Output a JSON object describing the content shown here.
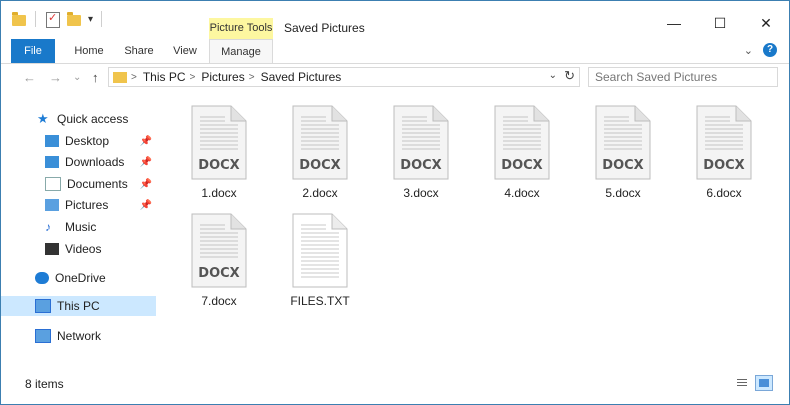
{
  "window": {
    "title": "Saved Pictures",
    "context_tab_group": "Picture Tools",
    "controls": {
      "minimize": "—",
      "maximize": "☐",
      "close": "✕"
    }
  },
  "quick_access_toolbar": {
    "dropdown": "▾"
  },
  "ribbon": {
    "tabs": [
      {
        "label": "File"
      },
      {
        "label": "Home"
      },
      {
        "label": "Share"
      },
      {
        "label": "View"
      },
      {
        "label": "Manage"
      }
    ],
    "collapse": "⌄",
    "help": "?"
  },
  "navigation": {
    "back": "←",
    "forward": "→",
    "recent": "⌄",
    "up": "↑",
    "breadcrumb": [
      "This PC",
      "Pictures",
      "Saved Pictures"
    ],
    "separator": ">",
    "dropdown": "⌄",
    "refresh": "↻",
    "search_placeholder": "Search Saved Pictures"
  },
  "sidebar": {
    "items": [
      {
        "label": "Quick access",
        "icon": "star-icon"
      },
      {
        "label": "Desktop",
        "icon": "desktop-icon",
        "pinned": true
      },
      {
        "label": "Downloads",
        "icon": "downloads-icon",
        "pinned": true
      },
      {
        "label": "Documents",
        "icon": "documents-icon",
        "pinned": true
      },
      {
        "label": "Pictures",
        "icon": "pictures-icon",
        "pinned": true
      },
      {
        "label": "Music",
        "icon": "music-icon"
      },
      {
        "label": "Videos",
        "icon": "videos-icon"
      },
      {
        "label": "OneDrive",
        "icon": "onedrive-icon"
      },
      {
        "label": "This PC",
        "icon": "this-pc-icon",
        "selected": true
      },
      {
        "label": "Network",
        "icon": "network-icon"
      }
    ],
    "pin_glyph": "📌"
  },
  "files": [
    {
      "name": "1.docx",
      "badge": "DOCX",
      "type": "docx"
    },
    {
      "name": "2.docx",
      "badge": "DOCX",
      "type": "docx"
    },
    {
      "name": "3.docx",
      "badge": "DOCX",
      "type": "docx"
    },
    {
      "name": "4.docx",
      "badge": "DOCX",
      "type": "docx"
    },
    {
      "name": "5.docx",
      "badge": "DOCX",
      "type": "docx"
    },
    {
      "name": "6.docx",
      "badge": "DOCX",
      "type": "docx"
    },
    {
      "name": "7.docx",
      "badge": "DOCX",
      "type": "docx"
    },
    {
      "name": "FILES.TXT",
      "badge": "",
      "type": "txt"
    }
  ],
  "status": {
    "item_count": "8 items"
  },
  "colors": {
    "accent": "#1979ca",
    "selection": "#cce8ff",
    "context_tab": "#fdf7a0"
  }
}
